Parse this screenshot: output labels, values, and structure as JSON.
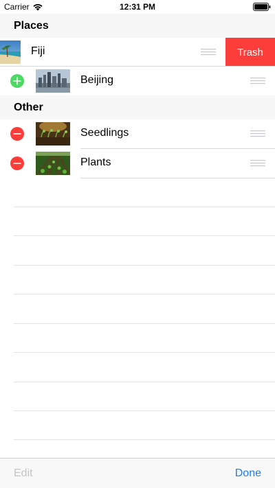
{
  "status_bar": {
    "carrier": "Carrier",
    "time": "12:31 PM"
  },
  "sections": [
    {
      "title": "Places",
      "rows": [
        {
          "label": "Fiji",
          "image": "fiji-beach-thumbnail",
          "swiped": true,
          "action_label": "Trash"
        },
        {
          "label": "Beijing",
          "image": "beijing-skyline-thumbnail",
          "control": "insert"
        }
      ]
    },
    {
      "title": "Other",
      "rows": [
        {
          "label": "Seedlings",
          "image": "seedlings-thumbnail",
          "control": "delete"
        },
        {
          "label": "Plants",
          "image": "plants-field-thumbnail",
          "control": "delete"
        }
      ]
    }
  ],
  "toolbar": {
    "edit_label": "Edit",
    "done_label": "Done"
  },
  "colors": {
    "delete": "#fc3d39",
    "insert": "#4cd964",
    "tint": "#1a7cf6",
    "disabled": "#c4c4c8"
  }
}
